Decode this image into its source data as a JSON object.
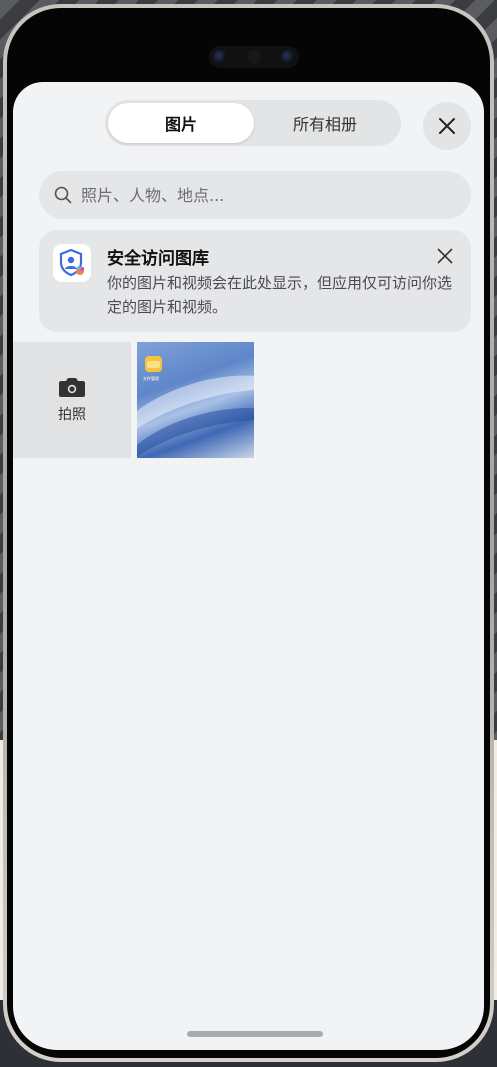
{
  "tabs": [
    {
      "label": "图片",
      "active": true
    },
    {
      "label": "所有相册",
      "active": false
    }
  ],
  "search": {
    "placeholder": "照片、人物、地点..."
  },
  "notice": {
    "title": "安全访问图库",
    "description": "你的图片和视频会在此处显示，但应用仅可访问你选定的图片和视频。"
  },
  "grid": {
    "camera_label": "拍照",
    "photos": [
      {
        "icon": "folder-icon",
        "folder_label": "文件管理"
      }
    ]
  },
  "colors": {
    "sheet_bg": "#f1f3f5",
    "chip_bg": "#e5e6e8",
    "accent_shield": "#3d6be0",
    "folder": "#f6c43a"
  },
  "icons": [
    "close-icon",
    "search-icon",
    "shield-user-icon",
    "camera-icon",
    "folder-icon"
  ]
}
